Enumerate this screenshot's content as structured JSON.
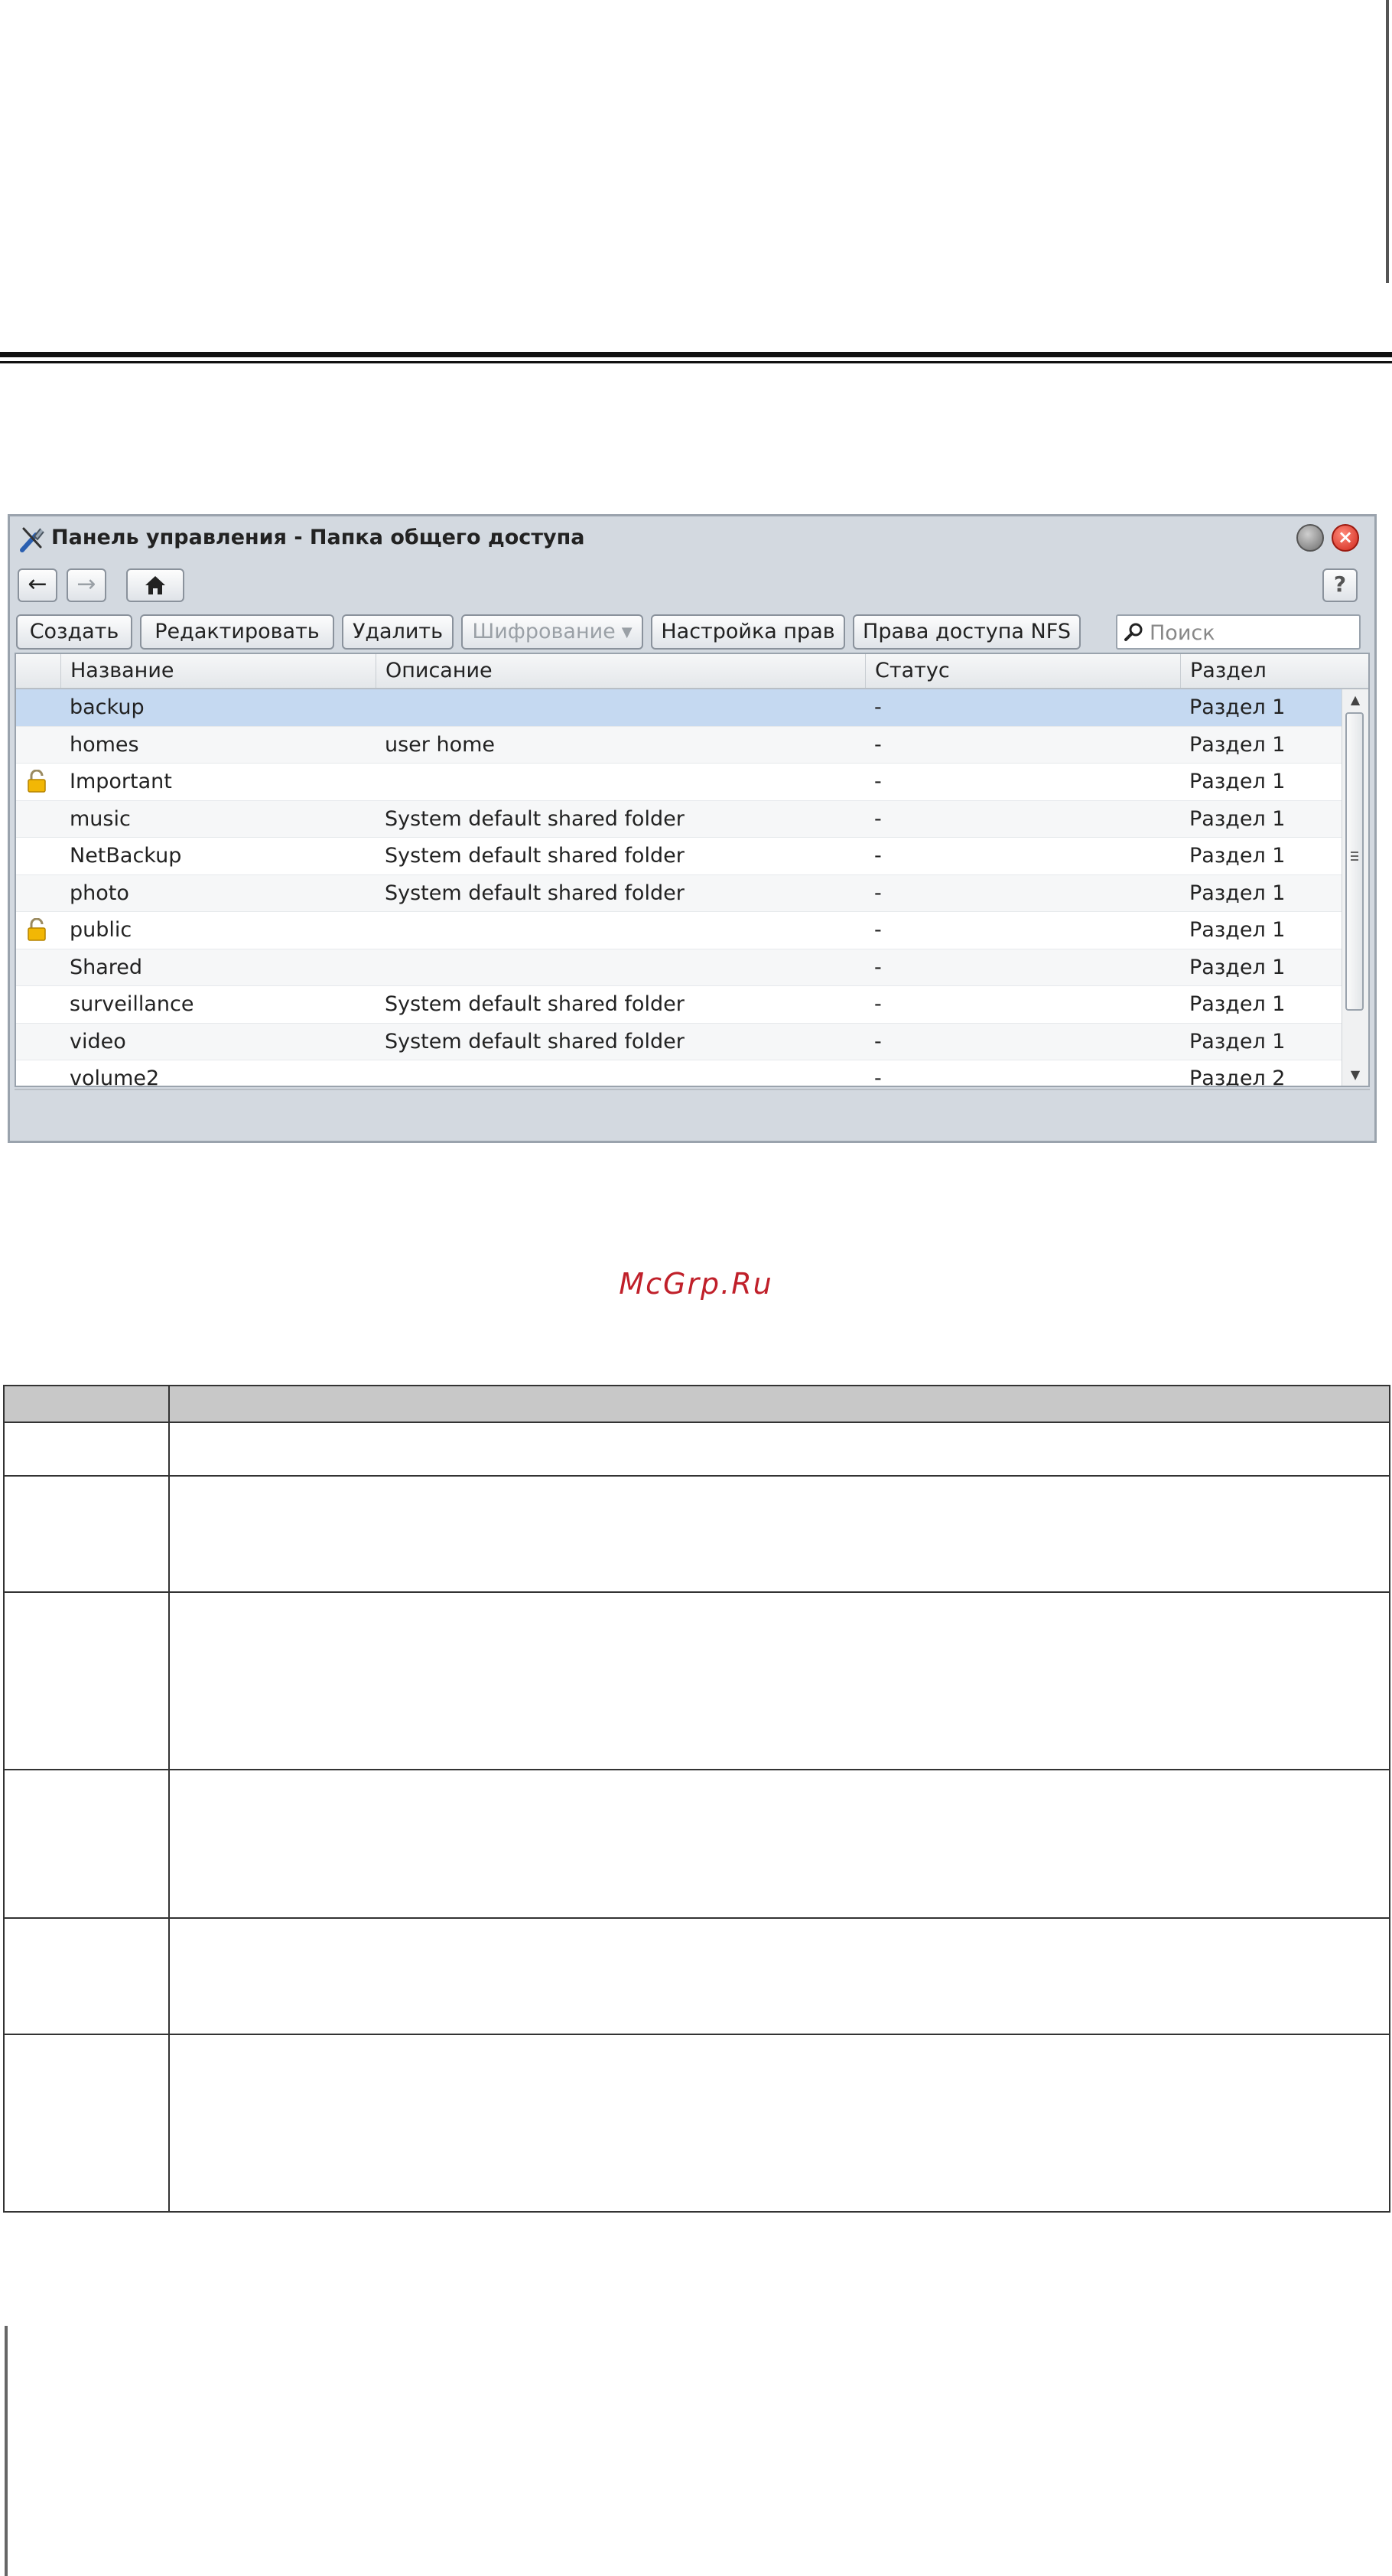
{
  "watermark": "McGrp.Ru",
  "window": {
    "title": "Панель управления - Папка общего доступа",
    "nav": {
      "back_icon": "arrow-left-icon",
      "forward_icon": "arrow-right-icon",
      "home_icon": "home-icon",
      "help": "?"
    }
  },
  "toolbar": {
    "create": "Создать",
    "edit": "Редактировать",
    "delete": "Удалить",
    "encryption": "Шифрование",
    "privileges": "Настройка прав",
    "nfs": "Права доступа NFS",
    "search_placeholder": "Поиск"
  },
  "grid": {
    "columns": [
      "Название",
      "Описание",
      "Статус",
      "Раздел"
    ],
    "rows": [
      {
        "name": "backup",
        "description": "",
        "status": "-",
        "volume": "Раздел 1",
        "locked": false,
        "selected": true
      },
      {
        "name": "homes",
        "description": "user home",
        "status": "-",
        "volume": "Раздел 1",
        "locked": false,
        "selected": false
      },
      {
        "name": "Important",
        "description": "",
        "status": "-",
        "volume": "Раздел 1",
        "locked": true,
        "selected": false
      },
      {
        "name": "music",
        "description": "System default shared folder",
        "status": "-",
        "volume": "Раздел 1",
        "locked": false,
        "selected": false
      },
      {
        "name": "NetBackup",
        "description": "System default shared folder",
        "status": "-",
        "volume": "Раздел 1",
        "locked": false,
        "selected": false
      },
      {
        "name": "photo",
        "description": "System default shared folder",
        "status": "-",
        "volume": "Раздел 1",
        "locked": false,
        "selected": false
      },
      {
        "name": "public",
        "description": "",
        "status": "-",
        "volume": "Раздел 1",
        "locked": true,
        "selected": false
      },
      {
        "name": "Shared",
        "description": "",
        "status": "-",
        "volume": "Раздел 1",
        "locked": false,
        "selected": false
      },
      {
        "name": "surveillance",
        "description": "System default shared folder",
        "status": "-",
        "volume": "Раздел 1",
        "locked": false,
        "selected": false
      },
      {
        "name": "video",
        "description": "System default shared folder",
        "status": "-",
        "volume": "Раздел 1",
        "locked": false,
        "selected": false
      },
      {
        "name": "volume2",
        "description": "",
        "status": "-",
        "volume": "Раздел 2",
        "locked": false,
        "selected": false
      }
    ]
  },
  "colors": {
    "selected_row": "#c5d9f1",
    "close_button": "#d0261a",
    "watermark": "#c0202a"
  }
}
